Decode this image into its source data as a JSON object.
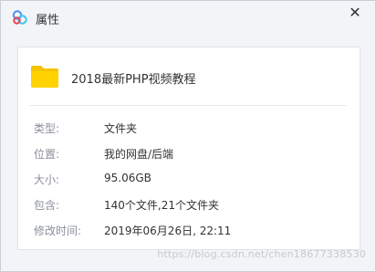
{
  "window": {
    "title": "属性",
    "close_icon": "close-icon"
  },
  "file": {
    "name": "2018最新PHP视频教程",
    "icon": "folder-icon"
  },
  "properties": [
    {
      "label": "类型:",
      "value": "文件夹"
    },
    {
      "label": "位置:",
      "value": "我的网盘/后端"
    },
    {
      "label": "大小:",
      "value": "95.06GB"
    },
    {
      "label": "包含:",
      "value": "140个文件,21个文件夹"
    },
    {
      "label": "修改时间:",
      "value": "2019年06月26日, 22:11"
    }
  ],
  "watermark": "https://blog.csdn.net/chen18677338530",
  "colors": {
    "window_bg": "#f2f4f7",
    "panel_bg": "#ffffff",
    "folder": "#ffd200",
    "label": "#8a8f99"
  }
}
